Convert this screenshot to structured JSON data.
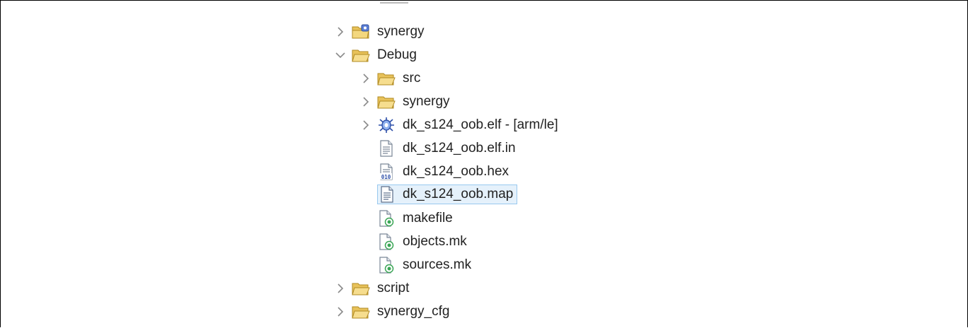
{
  "tree": {
    "items": [
      {
        "label": "synergy",
        "icon": "folder-link-icon",
        "expand": "collapsed",
        "level": 0
      },
      {
        "label": "Debug",
        "icon": "folder-open-icon",
        "expand": "expanded",
        "level": 0
      },
      {
        "label": "src",
        "icon": "folder-open-icon",
        "expand": "collapsed",
        "level": 1
      },
      {
        "label": "synergy",
        "icon": "folder-open-icon",
        "expand": "collapsed",
        "level": 1
      },
      {
        "label": "dk_s124_oob.elf - [arm/le]",
        "icon": "binary-bug-icon",
        "expand": "collapsed",
        "level": 1
      },
      {
        "label": "dk_s124_oob.elf.in",
        "icon": "text-file-icon",
        "expand": "none",
        "level": 1
      },
      {
        "label": "dk_s124_oob.hex",
        "icon": "binary-file-icon",
        "expand": "none",
        "level": 1
      },
      {
        "label": "dk_s124_oob.map",
        "icon": "text-file-icon",
        "expand": "none",
        "level": 1,
        "selected": true
      },
      {
        "label": "makefile",
        "icon": "make-file-icon",
        "expand": "none",
        "level": 1
      },
      {
        "label": "objects.mk",
        "icon": "make-file-icon",
        "expand": "none",
        "level": 1
      },
      {
        "label": "sources.mk",
        "icon": "make-file-icon",
        "expand": "none",
        "level": 1
      },
      {
        "label": "script",
        "icon": "folder-open-icon",
        "expand": "collapsed",
        "level": 0
      },
      {
        "label": "synergy_cfg",
        "icon": "folder-open-icon",
        "expand": "collapsed",
        "level": 0
      }
    ],
    "colors": {
      "folder": "#e8c25a",
      "folder_edge": "#b08a22",
      "selection_bg": "#e5f1fb",
      "selection_border": "#99c9ef",
      "chevron": "#8a8a8a",
      "text": "#222222"
    }
  }
}
